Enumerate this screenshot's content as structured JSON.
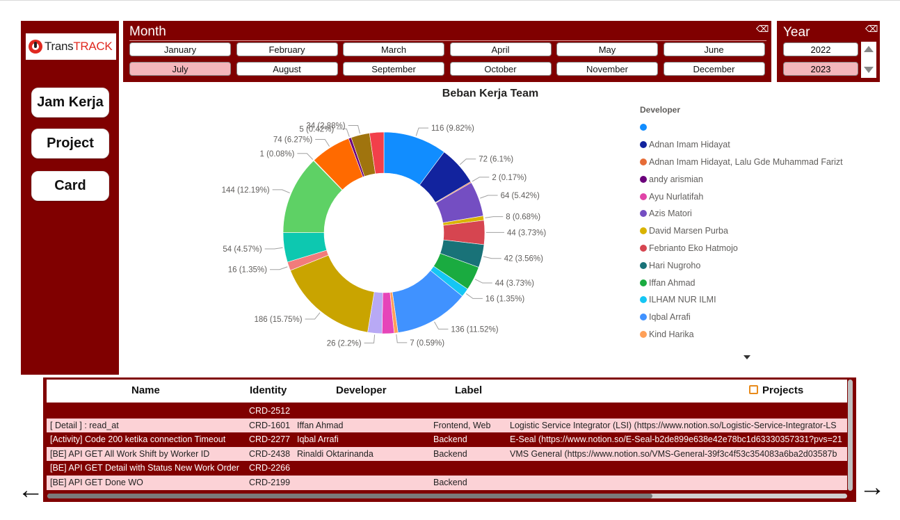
{
  "logo": {
    "text_main": "Trans",
    "text_accent": "TRACK"
  },
  "nav": {
    "jam_kerja": "Jam Kerja",
    "project": "Project",
    "card": "Card"
  },
  "month_slicer": {
    "title": "Month",
    "months": [
      "January",
      "February",
      "March",
      "April",
      "May",
      "June",
      "July",
      "August",
      "September",
      "October",
      "November",
      "December"
    ],
    "selected": "July"
  },
  "year_slicer": {
    "title": "Year",
    "years": [
      "2022",
      "2023"
    ],
    "selected": "2023"
  },
  "chart_data": {
    "type": "pie",
    "title": "Beban Kerja Team",
    "legend_title": "Developer",
    "legend_position": "right",
    "slices": [
      {
        "name": "",
        "value": 116,
        "label": "116 (9.82%)",
        "color": "#118DFF"
      },
      {
        "name": "Adnan Imam Hidayat",
        "value": 72,
        "label": "72 (6.1%)",
        "color": "#12239E"
      },
      {
        "name": "Adnan Imam Hidayat, Lalu Gde Muhammad Farizt",
        "value": 2,
        "label": "2 (0.17%)",
        "color": "#E66C37"
      },
      {
        "name": "andy arismian",
        "value": 0,
        "label": "",
        "color": "#6B007B"
      },
      {
        "name": "Ayu Nurlatifah",
        "value": 0,
        "label": "",
        "color": "#E044A7"
      },
      {
        "name": "Azis Matori",
        "value": 64,
        "label": "64 (5.42%)",
        "color": "#744EC2"
      },
      {
        "name": "David Marsen Purba",
        "value": 8,
        "label": "8 (0.68%)",
        "color": "#D9B300"
      },
      {
        "name": "Febrianto Eko Hatmojo",
        "value": 44,
        "label": "44 (3.73%)",
        "color": "#D64550"
      },
      {
        "name": "Hari Nugroho",
        "value": 42,
        "label": "42 (3.56%)",
        "color": "#197278"
      },
      {
        "name": "Iffan Ahmad",
        "value": 44,
        "label": "44 (3.73%)",
        "color": "#1AAB40"
      },
      {
        "name": "ILHAM NUR ILMI",
        "value": 16,
        "label": "16 (1.35%)",
        "color": "#15C6F4"
      },
      {
        "name": "Iqbal Arrafi",
        "value": 136,
        "label": "136 (11.52%)",
        "color": "#4092FF"
      },
      {
        "name": "Kind Harika",
        "value": 7,
        "label": "7 (0.59%)",
        "color": "#FFA058"
      },
      {
        "name": "",
        "value": 22,
        "label": "",
        "color": "#E645B9"
      },
      {
        "name": "",
        "value": 26,
        "label": "26 (2.2%)",
        "color": "#B8A9F5"
      },
      {
        "name": "",
        "value": 186,
        "label": "186 (15.75%)",
        "color": "#C9A400"
      },
      {
        "name": "",
        "value": 16,
        "label": "16 (1.35%)",
        "color": "#F27B7B"
      },
      {
        "name": "",
        "value": 54,
        "label": "54 (4.57%)",
        "color": "#0DC8B0"
      },
      {
        "name": "",
        "value": 144,
        "label": "144 (12.19%)",
        "color": "#5ED165"
      },
      {
        "name": "",
        "value": 1,
        "label": "1 (0.08%)",
        "color": "#A3D982"
      },
      {
        "name": "",
        "value": 74,
        "label": "74 (6.27%)",
        "color": "#FF6A00"
      },
      {
        "name": "",
        "value": 5,
        "label": "5 (0.42%)",
        "color": "#6B007B"
      },
      {
        "name": "",
        "value": 34,
        "label": "34 (2.88%)",
        "color": "#A0740E"
      },
      {
        "name": "",
        "value": 26,
        "label": "",
        "color": "#F2404A"
      }
    ]
  },
  "legend_items": [
    {
      "name": "",
      "color": "#118DFF"
    },
    {
      "name": "Adnan Imam Hidayat",
      "color": "#12239E"
    },
    {
      "name": "Adnan Imam Hidayat, Lalu Gde Muhammad Farizt",
      "color": "#E66C37"
    },
    {
      "name": "andy arismian",
      "color": "#6B007B"
    },
    {
      "name": "Ayu Nurlatifah",
      "color": "#E044A7"
    },
    {
      "name": "Azis Matori",
      "color": "#744EC2"
    },
    {
      "name": "David Marsen Purba",
      "color": "#D9B300"
    },
    {
      "name": "Febrianto Eko Hatmojo",
      "color": "#D64550"
    },
    {
      "name": "Hari Nugroho",
      "color": "#197278"
    },
    {
      "name": "Iffan Ahmad",
      "color": "#1AAB40"
    },
    {
      "name": "ILHAM NUR ILMI",
      "color": "#15C6F4"
    },
    {
      "name": "Iqbal Arrafi",
      "color": "#4092FF"
    },
    {
      "name": "Kind Harika",
      "color": "#FFA058"
    }
  ],
  "table": {
    "headers": {
      "name": "Name",
      "identity": "Identity",
      "developer": "Developer",
      "label": "Label",
      "projects": "Projects"
    },
    "rows": [
      {
        "name": "",
        "identity": "CRD-2512",
        "developer": "",
        "label": "",
        "projects": ""
      },
      {
        "name": "[ Detail ] : read_at",
        "identity": "CRD-1601",
        "developer": "Iffan Ahmad",
        "label": "Frontend, Web",
        "projects": "Logistic Service Integrator (LSI) (https://www.notion.so/Logistic-Service-Integrator-LS"
      },
      {
        "name": "[Activity] Code 200 ketika connection Timeout",
        "identity": "CRD-2277",
        "developer": "Iqbal Arrafi",
        "label": "Backend",
        "projects": "E-Seal (https://www.notion.so/E-Seal-b2de899e638e42e78bc1d63330357331?pvs=21"
      },
      {
        "name": "[BE] API GET All Work Shift by Worker ID",
        "identity": "CRD-2438",
        "developer": "Rinaldi Oktarinanda",
        "label": "Backend",
        "projects": "VMS General (https://www.notion.so/VMS-General-39f3c4f53c354083a6ba2d03587b"
      },
      {
        "name": "[BE] API GET Detail with Status New Work Order",
        "identity": "CRD-2266",
        "developer": "",
        "label": "",
        "projects": ""
      },
      {
        "name": "[BE] API GET Done WO",
        "identity": "CRD-2199",
        "developer": "",
        "label": "Backend",
        "projects": ""
      }
    ]
  },
  "arrows": {
    "back": "←",
    "forward": "→"
  }
}
